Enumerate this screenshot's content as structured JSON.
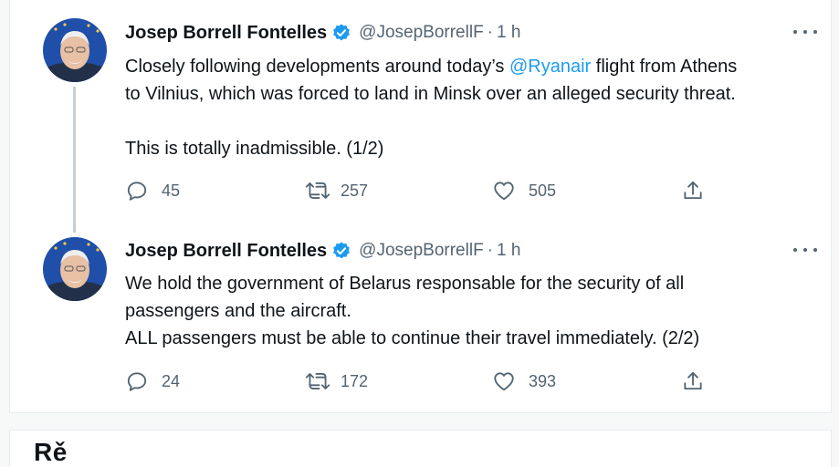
{
  "tweets": [
    {
      "author_name": "Josep Borrell Fontelles",
      "handle": "@JosepBorrellF",
      "separator": "·",
      "time": "1 h",
      "text_lines": [
        {
          "before": "Closely following developments around today’s ",
          "mention": "@Ryanair",
          "after": " flight from Athens"
        },
        {
          "before": "to Vilnius, which was forced to land in Minsk over an alleged security threat.",
          "mention": "",
          "after": ""
        }
      ],
      "text_second_paragraph": "This is totally inadmissible. (1/2)",
      "replies": "45",
      "retweets": "257",
      "likes": "505"
    },
    {
      "author_name": "Josep Borrell Fontelles",
      "handle": "@JosepBorrellF",
      "separator": "·",
      "time": "1 h",
      "text_lines": [
        "We hold the government of Belarus responsable for the security of all",
        "passengers and the aircraft.",
        "ALL passengers must be able to continue their travel immediately. (2/2)"
      ],
      "replies": "24",
      "retweets": "172",
      "likes": "393"
    }
  ],
  "next_section_heading": "Rě",
  "colors": {
    "accent": "#1d9bf0",
    "secondary_text": "#536471",
    "thread_line": "#c4cfd6"
  },
  "icons": {
    "reply": "reply-icon",
    "retweet": "retweet-icon",
    "like": "heart-icon",
    "share": "share-icon",
    "verified": "verified-badge-icon",
    "more": "more-icon"
  }
}
